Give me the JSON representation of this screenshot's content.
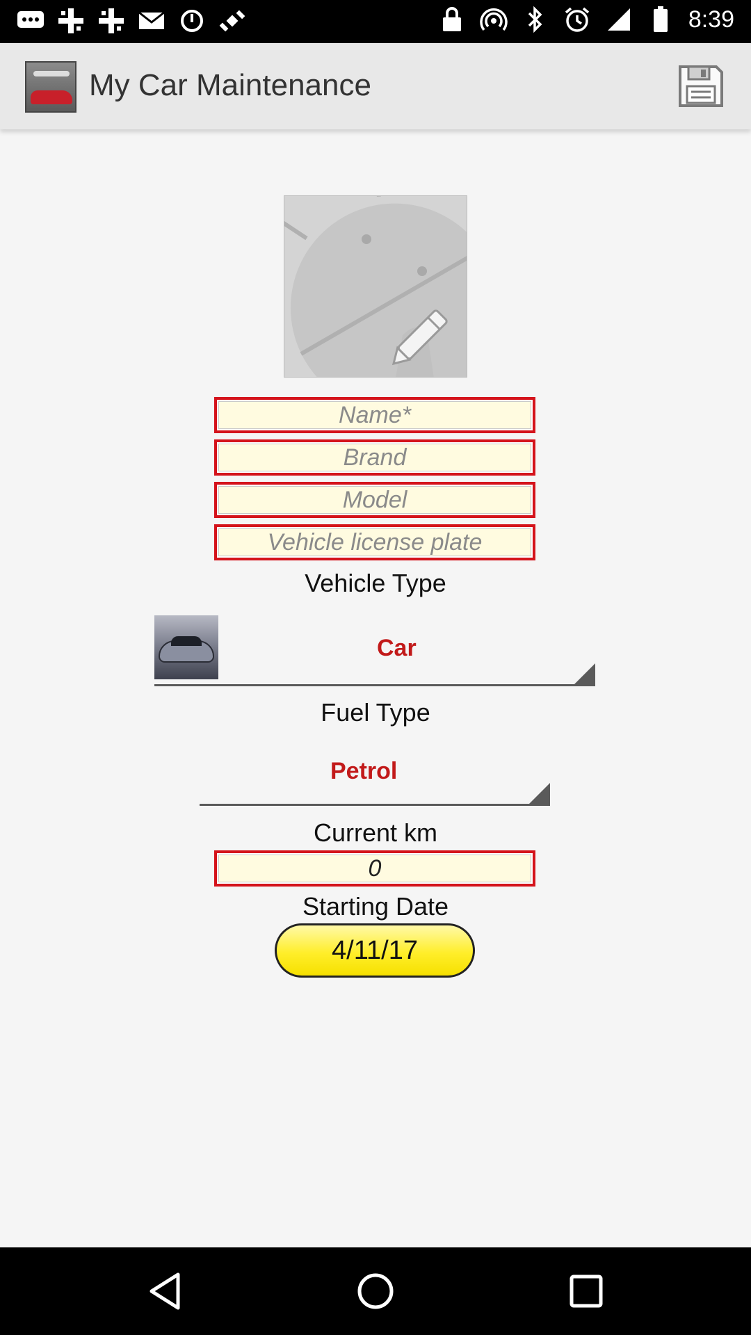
{
  "status_bar": {
    "time": "8:39",
    "left_icons": [
      "chat-icon",
      "grid-icon",
      "grid-icon",
      "mail-icon",
      "sync-icon",
      "satellite-icon"
    ],
    "right_icons": [
      "lock-icon",
      "hotspot-icon",
      "bluetooth-icon",
      "alarm-icon",
      "signal-icon",
      "battery-icon"
    ]
  },
  "app_bar": {
    "title": "My Car Maintenance",
    "logo_icon": "car-logo-icon",
    "action_icon": "save-icon"
  },
  "form": {
    "name": {
      "placeholder": "Name*",
      "value": ""
    },
    "brand": {
      "placeholder": "Brand",
      "value": ""
    },
    "model": {
      "placeholder": "Model",
      "value": ""
    },
    "plate": {
      "placeholder": "Vehicle license plate",
      "value": ""
    },
    "vehicle_type_label": "Vehicle Type",
    "vehicle_type_value": "Car",
    "fuel_type_label": "Fuel Type",
    "fuel_type_value": "Petrol",
    "current_km_label": "Current km",
    "current_km_value": "0",
    "starting_date_label": "Starting Date",
    "starting_date_value": "4/11/17"
  },
  "colors": {
    "field_border": "#d4131b",
    "field_fill": "#fffbe0",
    "spinner_value": "#c21a1a",
    "date_pill": "#ffee2a"
  },
  "nav_bar": {
    "back_icon": "back-icon",
    "home_icon": "home-icon",
    "recents_icon": "recents-icon"
  }
}
